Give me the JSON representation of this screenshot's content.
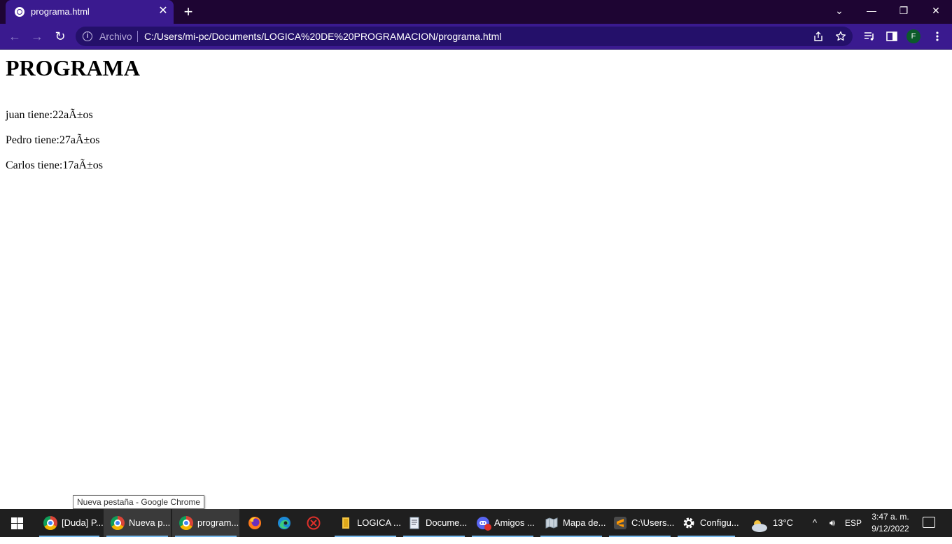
{
  "browser": {
    "tab": {
      "title": "programa.html",
      "favicon": "globe-icon",
      "close": "✕"
    },
    "new_tab": "+",
    "window_controls": {
      "tab_search": "⌄",
      "minimize": "—",
      "restore": "❐",
      "close": "✕"
    },
    "toolbar": {
      "back": "←",
      "forward": "→",
      "reload": "↻"
    },
    "omnibox": {
      "info": "i",
      "scheme_label": "Archivo",
      "url": "C:/Users/mi-pc/Documents/LOGICA%20DE%20PROGRAMACION/programa.html",
      "share_icon": "share-icon",
      "bookmark_icon": "star-icon"
    },
    "profile_initial": "F",
    "colors": {
      "frame": "#1e0533",
      "toolbar": "#3a1a8f",
      "omnibox": "#24106a"
    }
  },
  "page": {
    "heading": "PROGRAMA",
    "lines": [
      "juan tiene:22aÃ±os",
      "Pedro tiene:27aÃ±os",
      "Carlos tiene:17aÃ±os"
    ]
  },
  "tooltip": "Nueva pestaña - Google Chrome",
  "taskbar": {
    "items": [
      {
        "label": "[Duda] P...",
        "icon": "chrome-icon",
        "running": true,
        "active": false
      },
      {
        "label": "Nueva p...",
        "icon": "chrome-icon",
        "running": true,
        "active": true
      },
      {
        "label": "program...",
        "icon": "chrome-icon",
        "running": true,
        "active": true
      },
      {
        "label": "",
        "icon": "firefox-icon",
        "running": false,
        "active": false
      },
      {
        "label": "",
        "icon": "edge-icon",
        "running": false,
        "active": false
      },
      {
        "label": "",
        "icon": "game-launcher-icon",
        "running": false,
        "active": false
      },
      {
        "label": "LOGICA ...",
        "icon": "folder-icon",
        "running": true,
        "active": false
      },
      {
        "label": "Docume...",
        "icon": "notepad-icon",
        "running": true,
        "active": false
      },
      {
        "label": "Amigos ...",
        "icon": "discord-icon",
        "running": true,
        "active": false,
        "badge": "9+"
      },
      {
        "label": "Mapa de...",
        "icon": "map-app-icon",
        "running": true,
        "active": false
      },
      {
        "label": "C:\\Users...",
        "icon": "sublime-text-icon",
        "running": true,
        "active": false
      },
      {
        "label": "Configu...",
        "icon": "settings-gear-icon",
        "running": true,
        "active": false
      }
    ],
    "weather": {
      "temp": "13°C",
      "icon": "partly-cloudy-icon"
    },
    "tray": {
      "chevron": "^",
      "volume": "🔊︎",
      "language": "ESP"
    },
    "clock": {
      "time": "3:47 a. m.",
      "date": "9/12/2022"
    }
  }
}
